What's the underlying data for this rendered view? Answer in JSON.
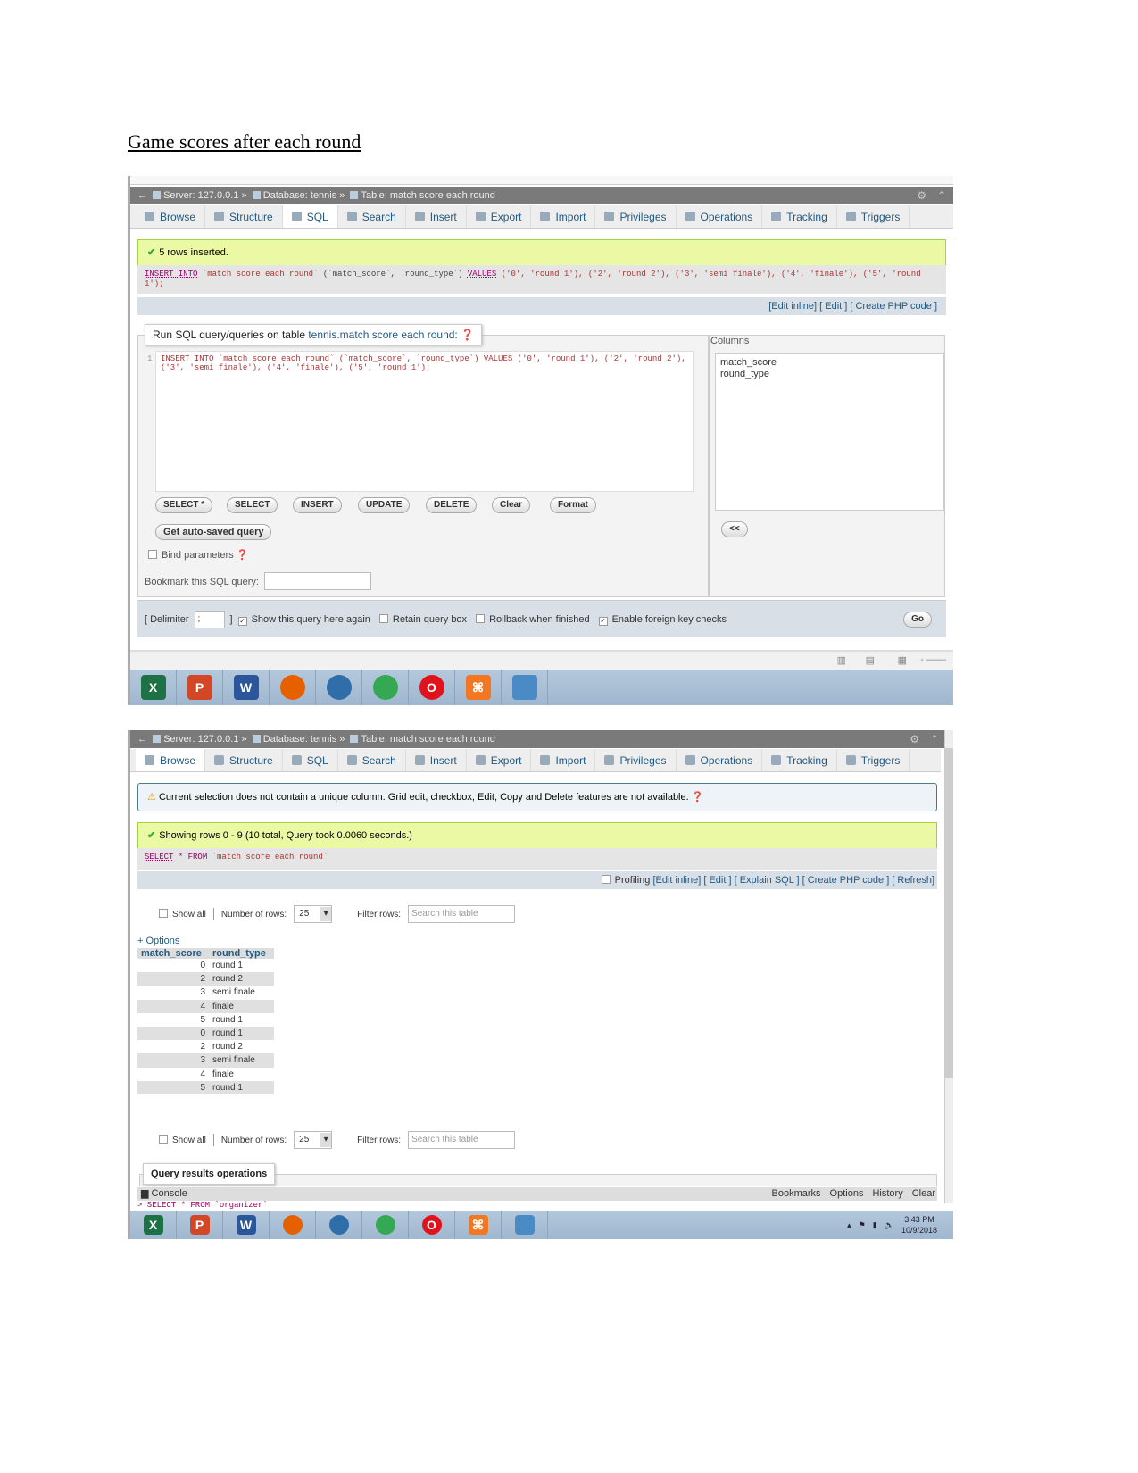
{
  "document": {
    "title": "Game scores after each round"
  },
  "breadcrumb": {
    "server": "Server: 127.0.0.1 »",
    "database": "Database: tennis »",
    "table": "Table: match score each round"
  },
  "tabs": [
    {
      "label": "Browse",
      "icon": "browse-icon"
    },
    {
      "label": "Structure",
      "icon": "structure-icon"
    },
    {
      "label": "SQL",
      "icon": "sql-icon"
    },
    {
      "label": "Search",
      "icon": "search-icon"
    },
    {
      "label": "Insert",
      "icon": "insert-icon"
    },
    {
      "label": "Export",
      "icon": "export-icon"
    },
    {
      "label": "Import",
      "icon": "import-icon"
    },
    {
      "label": "Privileges",
      "icon": "privileges-icon"
    },
    {
      "label": "Operations",
      "icon": "operations-icon"
    },
    {
      "label": "Tracking",
      "icon": "tracking-icon"
    },
    {
      "label": "Triggers",
      "icon": "triggers-icon"
    }
  ],
  "shot1": {
    "message": "5 rows inserted.",
    "sql_kw1": "INSERT INTO",
    "sql_tbl": "`match score each round`",
    "sql_cols": "(`match_score`, `round_type`)",
    "sql_kw2": "VALUES",
    "sql_vals": "('0', 'round 1'), ('2', 'round 2'), ('3', 'semi finale'), ('4', 'finale'), ('5', 'round 1');",
    "links": {
      "edit_inline": "[Edit inline]",
      "edit": "[ Edit ]",
      "create_php": "[ Create PHP code ]"
    },
    "legend_prefix": "Run SQL query/queries on table ",
    "legend_table": "tennis.match score each round:",
    "editor_line": "1",
    "editor_text": "INSERT INTO `match score each round` (`match_score`, `round_type`) VALUES ('0', 'round 1'), ('2', 'round 2'), ('3', 'semi finale'), ('4', 'finale'), ('5', 'round 1');",
    "columns_label": "Columns",
    "columns": [
      "match_score",
      "round_type"
    ],
    "buttons": [
      "SELECT *",
      "SELECT",
      "INSERT",
      "UPDATE",
      "DELETE",
      "Clear",
      "Format"
    ],
    "autosave": "Get auto-saved query",
    "insert_cols": "<<",
    "bind_params": "Bind parameters",
    "bookmark_label": "Bookmark this SQL query:",
    "delimiter_label": "[ Delimiter",
    "delimiter_value": ";",
    "delimiter_end": "]",
    "options": [
      {
        "label": "Show this query here again",
        "checked": true
      },
      {
        "label": "Retain query box",
        "checked": false
      },
      {
        "label": "Rollback when finished",
        "checked": false
      },
      {
        "label": "Enable foreign key checks",
        "checked": true
      }
    ],
    "go": "Go"
  },
  "taskbar_apps": [
    {
      "name": "excel",
      "label": "X",
      "color": "#1e7145"
    },
    {
      "name": "powerpoint",
      "label": "P",
      "color": "#d24726"
    },
    {
      "name": "word",
      "label": "W",
      "color": "#2b579a"
    },
    {
      "name": "firefox",
      "label": "",
      "color": "#e66000"
    },
    {
      "name": "thunderbird",
      "label": "",
      "color": "#2f6ea8"
    },
    {
      "name": "chrome",
      "label": "",
      "color": "#34a853"
    },
    {
      "name": "opera",
      "label": "O",
      "color": "#e0131c"
    },
    {
      "name": "xampp",
      "label": "⌘",
      "color": "#f37623"
    },
    {
      "name": "photo-viewer",
      "label": "",
      "color": "#4a8bc6"
    }
  ],
  "shot2": {
    "warning": "Current selection does not contain a unique column. Grid edit, checkbox, Edit, Copy and Delete features are not available.",
    "message": "Showing rows 0 - 9 (10 total, Query took 0.0060 seconds.)",
    "sql_kw": "SELECT",
    "sql_rest": "* FROM",
    "sql_tbl": "`match score each round`",
    "links": {
      "profiling": "Profiling",
      "edit_inline": "[Edit inline]",
      "edit": "[ Edit ]",
      "explain": "[ Explain SQL ]",
      "create_php": "[ Create PHP code ]",
      "refresh": "[ Refresh]"
    },
    "show_all": "Show all",
    "num_rows_label": "Number of rows:",
    "num_rows": "25",
    "filter_label": "Filter rows:",
    "filter_placeholder": "Search this table",
    "options_link": "+ Options",
    "headers": [
      "match_score",
      "round_type"
    ],
    "rows": [
      [
        "0",
        "round 1"
      ],
      [
        "2",
        "round 2"
      ],
      [
        "3",
        "semi finale"
      ],
      [
        "4",
        "finale"
      ],
      [
        "5",
        "round 1"
      ],
      [
        "0",
        "round 1"
      ],
      [
        "2",
        "round 2"
      ],
      [
        "3",
        "semi finale"
      ],
      [
        "4",
        "finale"
      ],
      [
        "5",
        "round 1"
      ]
    ],
    "query_ops": "Query results operations",
    "console": "Console",
    "console_links": [
      "Bookmarks",
      "Options",
      "History",
      "Clear"
    ],
    "console_text": "> SELECT * FROM `organizer`",
    "clock_time": "3:43 PM",
    "clock_date": "10/9/2018"
  }
}
